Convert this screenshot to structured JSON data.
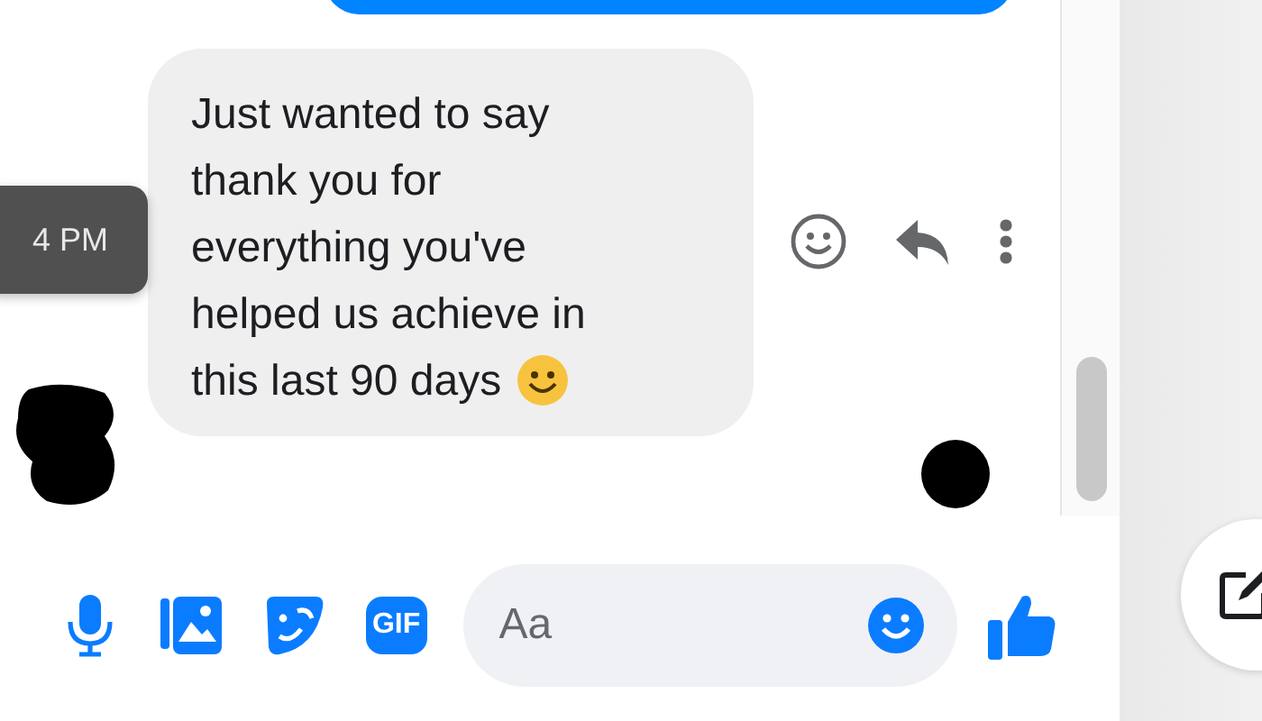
{
  "message": {
    "lines": [
      "Just wanted to say",
      "thank you for",
      "everything you've",
      "helped us achieve in",
      "this last 90 days"
    ]
  },
  "tooltip": {
    "time": "4 PM"
  },
  "composer": {
    "gif_label": "GIF",
    "placeholder": "Aa"
  }
}
